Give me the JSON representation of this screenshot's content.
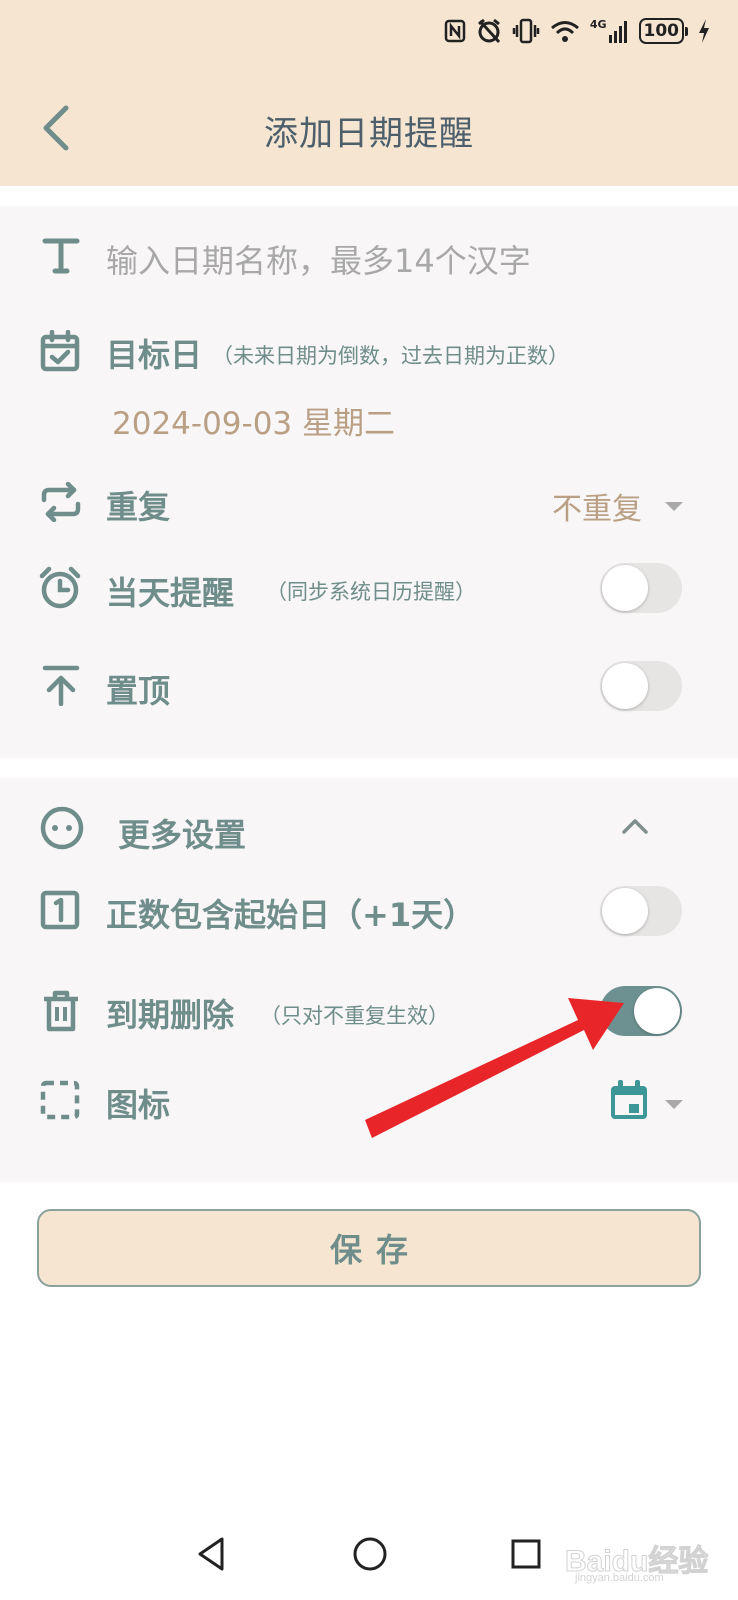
{
  "status_bar": {
    "battery": "100",
    "network": "4G",
    "icons": [
      "nfc-icon",
      "alarm-off-icon",
      "vibrate-icon",
      "wifi-icon",
      "signal-icon",
      "battery-icon",
      "charging-icon"
    ]
  },
  "header": {
    "title": "添加日期提醒"
  },
  "form": {
    "name_placeholder": "输入日期名称，最多14个汉字",
    "target_label": "目标日",
    "target_note": "（未来日期为倒数，过去日期为正数）",
    "target_date": "2024-09-03 星期二",
    "repeat_label": "重复",
    "repeat_value": "不重复",
    "reminder_label": "当天提醒",
    "reminder_note": "（同步系统日历提醒）",
    "reminder_on": false,
    "pin_label": "置顶",
    "pin_on": false
  },
  "more": {
    "label": "更多设置",
    "include_start_label": "正数包含起始日（+1天）",
    "include_start_on": false,
    "expire_delete_label": "到期删除",
    "expire_delete_note": "（只对不重复生效）",
    "expire_delete_on": true,
    "icon_label": "图标",
    "icon_value": "calendar-icon"
  },
  "save_label": "保存",
  "watermark": {
    "text": "Baidu经验",
    "sub": "jingyan.baidu.com"
  },
  "colors": {
    "header_bg": "#f6e6d1",
    "accent": "#6f8d8a",
    "toggle_on": "#6d9190",
    "date_text": "#b9a085",
    "arrow": "#e8262a"
  }
}
